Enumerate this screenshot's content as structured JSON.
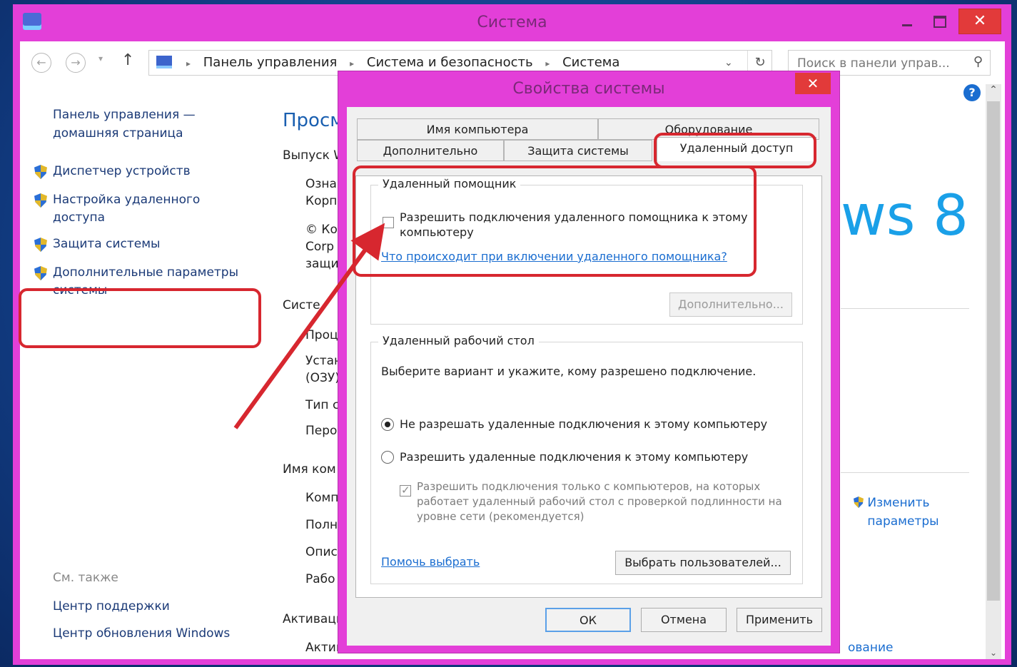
{
  "window": {
    "title": "Система",
    "close_label": "✕"
  },
  "address_bar": {
    "back_icon": "←",
    "forward_icon": "→",
    "up_icon": "↑",
    "breadcrumbs": [
      "Панель управления",
      "Система и безопасность",
      "Система"
    ],
    "separator": "▸",
    "dropdown_icon": "⌄",
    "refresh_icon": "↻",
    "search_placeholder": "Поиск в панели управ...",
    "search_icon": "⚲"
  },
  "sidebar": {
    "home": "Панель управления — домашняя страница",
    "items": [
      {
        "label": "Диспетчер устройств"
      },
      {
        "label": "Настройка удаленного доступа"
      },
      {
        "label": "Защита системы"
      },
      {
        "label": "Дополнительные параметры системы"
      }
    ],
    "see_also": "См. также",
    "links": [
      {
        "label": "Центр поддержки"
      },
      {
        "label": "Центр обновления Windows"
      }
    ]
  },
  "background": {
    "title_partial": "Просм",
    "edition_partial": "Выпуск W",
    "line1": "Озна",
    "line2": "Корп",
    "line3": "© Ко",
    "line4": "Corp",
    "line5": "защи",
    "system_head": "Систе",
    "sys1": "Проц",
    "sys2": "Устан",
    "sys3": "(ОЗУ)",
    "sys4": "Тип с",
    "sys5": "Перо",
    "name_head": "Имя ком",
    "name1": "Комп",
    "name2": "Полн",
    "name3": "Опис",
    "name4": "Рабо",
    "activation_head": "Активаци",
    "activation_line_start": "Актив",
    "activation_line_end": "ование",
    "windows_logo_text": "ws 8",
    "change_link": "Изменить параметры",
    "help_icon": "?"
  },
  "dialog": {
    "title": "Свойства системы",
    "close_label": "✕",
    "tabs_row1": [
      "Имя компьютера",
      "Оборудование"
    ],
    "tabs_row2": [
      "Дополнительно",
      "Защита системы",
      "Удаленный доступ"
    ],
    "active_tab": "Удаленный доступ",
    "remote_assistance": {
      "group_title": "Удаленный помощник",
      "checkbox_label": "Разрешить подключения удаленного помощника к этому компьютеру",
      "checkbox_checked": false,
      "link": "Что происходит при включении удаленного помощника?",
      "advanced_button": "Дополнительно..."
    },
    "remote_desktop": {
      "group_title": "Удаленный рабочий стол",
      "instruction": "Выберите вариант и укажите, кому разрешено подключение.",
      "option_deny": "Не разрешать удаленные подключения к этому компьютеру",
      "option_allow": "Разрешить удаленные подключения к этому компьютеру",
      "selected": "deny",
      "nla_checkbox": "Разрешить подключения только с компьютеров, на которых работает удаленный рабочий стол с проверкой подлинности на уровне сети (рекомендуется)",
      "nla_checked": true,
      "help_link": "Помочь выбрать",
      "select_users_button": "Выбрать пользователей..."
    },
    "buttons": {
      "ok": "ОК",
      "cancel": "Отмена",
      "apply": "Применить"
    }
  },
  "annotations": {
    "highlight_color": "#d7272f",
    "arrow_color": "#d7272f"
  },
  "colors": {
    "title_bar": "#e33fd8",
    "desktop": "#1f5bb8",
    "link": "#1a6dd0",
    "close_button": "#e23a3a"
  }
}
